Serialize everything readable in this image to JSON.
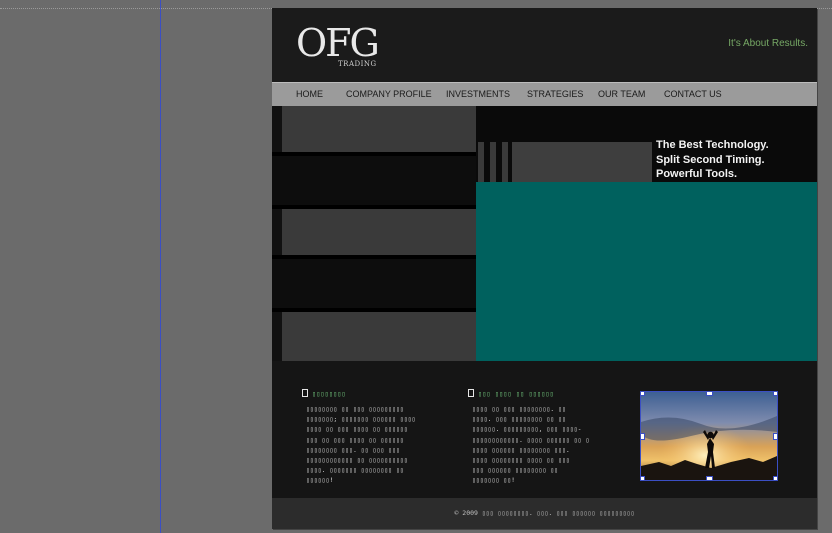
{
  "logo": {
    "main": "OFG",
    "sub": "TRADING"
  },
  "tagline": "It's About Results.",
  "nav": [
    "HOME",
    "COMPANY PROFILE",
    "INVESTMENTS",
    "STRATEGIES",
    "OUR TEAM",
    "CONTACT US"
  ],
  "hero": {
    "lines": [
      "The Best Technology.",
      "Split Second Timing.",
      "Powerful Tools."
    ]
  },
  "columns": [
    {
      "heading": "▯▯▯▯▯▯▯▯",
      "body": [
        "▯▯▯▯▯▯▯▯ ▯▯ ▯▯▯ ▯▯▯▯▯▯▯▯▯",
        "▯▯▯▯▯▯▯; ▯▯▯▯▯▯▯ ▯▯▯▯▯▯ ▯▯▯▯",
        "▯▯▯▯ ▯▯ ▯▯▯ ▯▯▯▯ ▯▯ ▯▯▯▯▯▯",
        "▯▯▯ ▯▯ ▯▯▯ ▯▯▯▯ ▯▯ ▯▯▯▯▯▯",
        "▯▯▯▯▯▯▯▯ ▯▯▯. ▯▯ ▯▯▯ ▯▯▯",
        "▯▯▯▯▯▯▯▯▯▯▯▯ ▯▯ ▯▯▯▯▯▯▯▯▯▯",
        "▯▯▯▯. ▯▯▯▯▯▯▯ ▯▯▯▯▯▯▯▯ ▯▯",
        "▯▯▯▯▯▯!"
      ]
    },
    {
      "heading": "▯▯▯ ▯▯▯▯ ▯▯ ▯▯▯▯▯▯",
      "body": [
        "▯▯▯▯ ▯▯ ▯▯▯ ▯▯▯▯▯▯▯▯. ▯▯",
        "▯▯▯▯. ▯▯▯ ▯▯▯▯▯▯▯▯ ▯▯ ▯▯",
        "▯▯▯▯▯▯. ▯▯▯▯▯▯▯▯▯, ▯▯▯ ▯▯▯▯-",
        "▯▯▯▯▯▯▯▯▯▯▯▯. ▯▯▯▯ ▯▯▯▯▯▯ ▯▯ ▯",
        "▯▯▯▯ ▯▯▯▯▯▯ ▯▯▯▯▯▯▯▯ ▯▯▯.",
        "▯▯▯▯ ▯▯▯▯▯▯▯▯ ▯▯▯▯ ▯▯ ▯▯▯",
        "▯▯▯ ▯▯▯▯▯▯ ▯▯▯▯▯▯▯▯ ▯▯",
        "▯▯▯▯▯▯▯ ▯▯!"
      ]
    }
  ],
  "footer": "© 2009 ▯▯▯ ▯▯▯▯▯▯▯▯. ▯▯▯. ▯▯▯ ▯▯▯▯▯▯ ▯▯▯▯▯▯▯▯▯"
}
